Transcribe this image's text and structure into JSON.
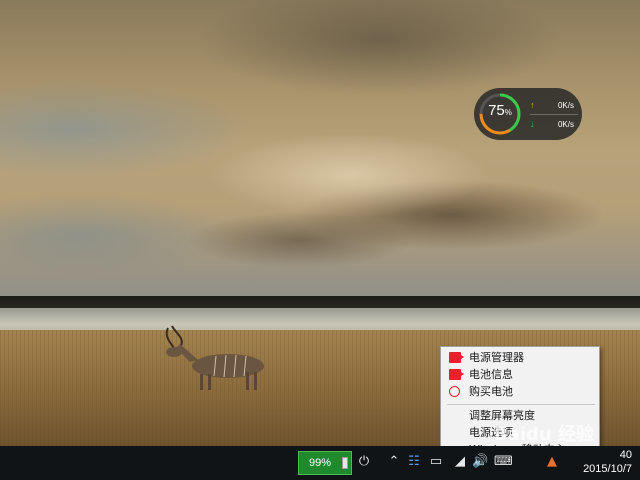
{
  "widget": {
    "percent": "75",
    "percent_unit": "%",
    "upload_speed": "0K/s",
    "download_speed": "0K/s",
    "ring_fraction": 0.75,
    "colors": {
      "ring_green": "#3cc84a",
      "ring_orange": "#f28c1a",
      "up_arrow": "#f2a000",
      "down_arrow": "#39c24a"
    }
  },
  "context_menu": {
    "items": [
      {
        "label": "电源管理器",
        "icon": "red-tag-icon"
      },
      {
        "label": "电池信息",
        "icon": "red-tag-icon"
      },
      {
        "label": "购买电池",
        "icon": "globe-icon"
      },
      {
        "label": "调整屏幕亮度",
        "icon": ""
      },
      {
        "label": "电源选项",
        "icon": ""
      },
      {
        "label": "Windows 移动中心",
        "icon": ""
      }
    ]
  },
  "taskbar": {
    "battery_percent": "99%",
    "clock_time": "40",
    "clock_date": "2015/10/7",
    "tray_icons": [
      "power-plug-icon",
      "chevron-up-icon",
      "network-adapter-icon",
      "battery-icon",
      "wifi-icon",
      "volume-icon",
      "input-method-icon",
      "notification-icon"
    ],
    "colors": {
      "battery_fill": "#1e8a2d"
    }
  },
  "watermark": {
    "text": "Baidu 经验"
  }
}
